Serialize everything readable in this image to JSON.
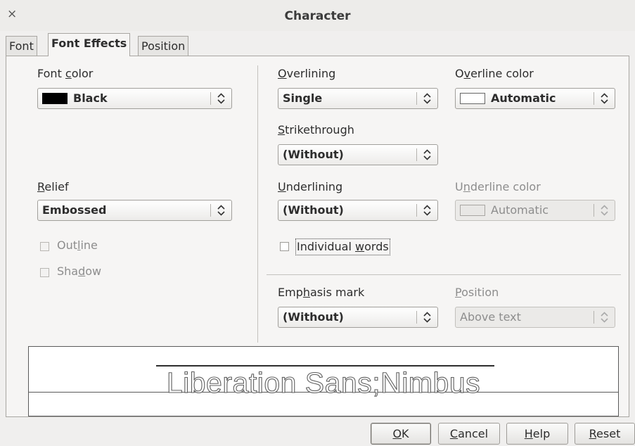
{
  "window": {
    "title": "Character",
    "close_glyph": "×"
  },
  "tabs": [
    {
      "label": "Font",
      "active": false
    },
    {
      "label": "Font Effects",
      "active": true
    },
    {
      "label": "Position",
      "active": false
    }
  ],
  "font_color": {
    "label_pre": "Font ",
    "label_key": "c",
    "label_post": "olor",
    "value": "Black",
    "swatch": "#000000"
  },
  "relief": {
    "label_key": "R",
    "label_post": "elief",
    "value": "Embossed"
  },
  "outline": {
    "label_pre": "Out",
    "label_key": "l",
    "label_post": "ine",
    "checked": false,
    "enabled": false
  },
  "shadow": {
    "label_pre": "Sha",
    "label_key": "d",
    "label_post": "ow",
    "checked": false,
    "enabled": false
  },
  "overlining": {
    "label_key": "O",
    "label_post": "verlining",
    "value": "Single"
  },
  "overline_color": {
    "label_pre": "O",
    "label_key": "v",
    "label_post": "erline color",
    "value": "Automatic",
    "swatch": "#ffffff"
  },
  "strikethrough": {
    "label_key": "S",
    "label_post": "trikethrough",
    "value": "(Without)"
  },
  "underlining": {
    "label_key": "U",
    "label_post": "nderlining",
    "value": "(Without)"
  },
  "underline_color": {
    "label_pre": "U",
    "label_key": "n",
    "label_post": "derline color",
    "value": "Automatic",
    "enabled": false
  },
  "individual_words": {
    "label_pre": "Individual ",
    "label_key": "w",
    "label_post": "ords",
    "checked": false
  },
  "emphasis_mark": {
    "label_pre": "Emp",
    "label_key": "h",
    "label_post": "asis mark",
    "value": "(Without)"
  },
  "position": {
    "label_key": "P",
    "label_post": "osition",
    "value": "Above text",
    "enabled": false
  },
  "preview": {
    "text": "Liberation Sans;Nimbus"
  },
  "buttons": {
    "ok": {
      "key": "O",
      "post": "K"
    },
    "cancel": {
      "key": "C",
      "post": "ancel"
    },
    "help": {
      "key": "H",
      "post": "elp"
    },
    "reset": {
      "key": "R",
      "post": "eset"
    }
  }
}
